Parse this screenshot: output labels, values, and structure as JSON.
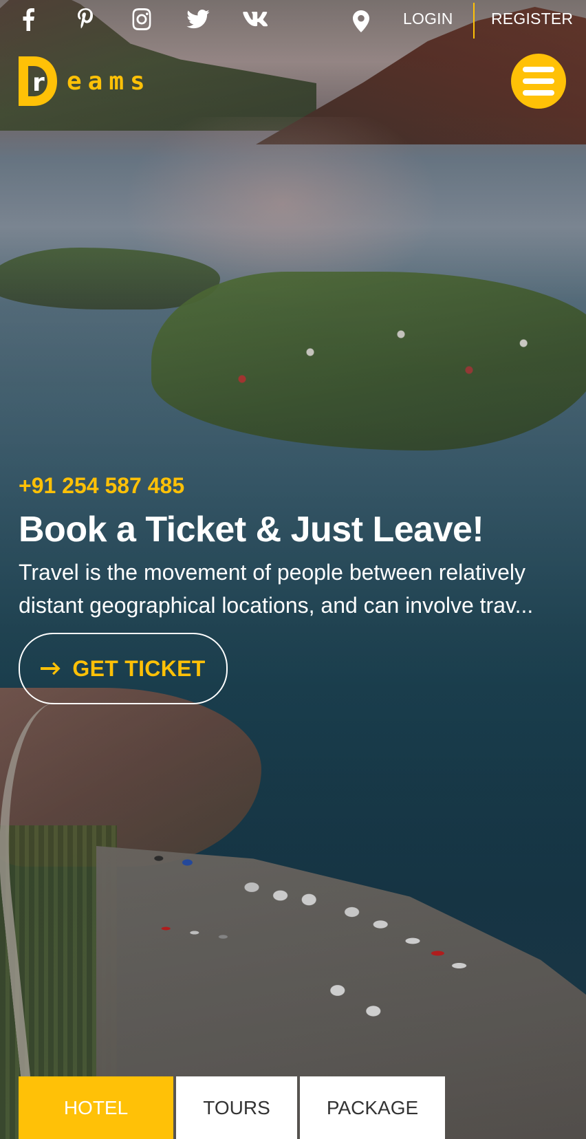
{
  "topbar": {
    "social": [
      {
        "icon": "facebook-icon"
      },
      {
        "icon": "pinterest-icon"
      },
      {
        "icon": "instagram-icon"
      },
      {
        "icon": "twitter-icon"
      },
      {
        "icon": "vk-icon"
      }
    ],
    "location_icon": "map-pin-icon",
    "login_label": "LOGIN",
    "register_label": "REGISTER"
  },
  "logo": {
    "letter_d": "D",
    "letter_r": "r",
    "rest": "eams"
  },
  "menu": {
    "icon": "hamburger-menu-icon"
  },
  "hero": {
    "phone": "+91 254 587 485",
    "title": "Book a Ticket & Just Leave!",
    "description_line1": "Travel is the movement of people between relatively",
    "description_line2": "distant geographical locations, and can involve trav...",
    "button_label": "GET TICKET",
    "button_icon": "arrow-right-icon"
  },
  "tabs": [
    {
      "label": "HOTEL",
      "active": true
    },
    {
      "label": "TOURS",
      "active": false
    },
    {
      "label": "PACKAGE",
      "active": false
    }
  ],
  "colors": {
    "accent": "#ffc107",
    "text_light": "#ffffff",
    "tab_text": "#333333"
  }
}
